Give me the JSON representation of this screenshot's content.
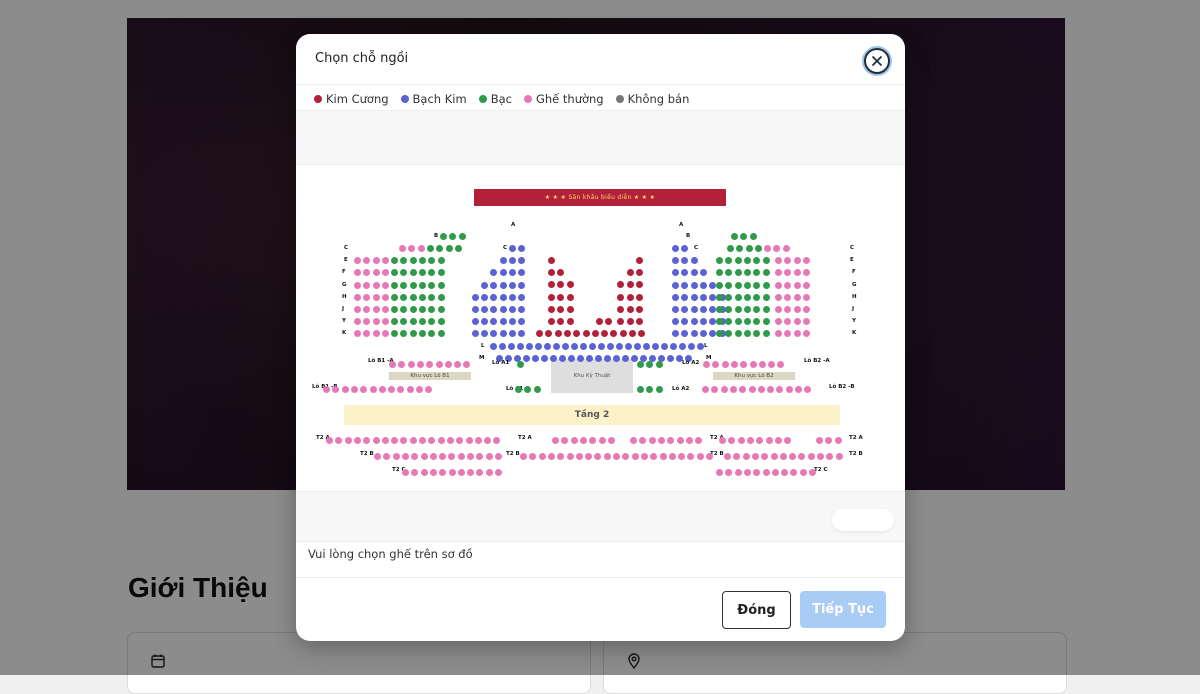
{
  "page": {
    "intro_title": "Giới Thiệu"
  },
  "modal": {
    "title": "Chọn chỗ ngồi",
    "legend": [
      {
        "label": "Kim Cương",
        "color": "#b3203a"
      },
      {
        "label": "Bạch Kim",
        "color": "#5b62d6"
      },
      {
        "label": "Bạc",
        "color": "#2f9b4a"
      },
      {
        "label": "Ghế thường",
        "color": "#e778b6"
      },
      {
        "label": "Không bán",
        "color": "#757575"
      }
    ],
    "hint": "Vui lòng chọn ghế trên sơ đồ",
    "close_button": "Đóng",
    "next_button": "Tiếp Tục"
  },
  "seatmap": {
    "stage_label": "★ ★ ★  Sân khấu biểu diễn  ★ ★ ★",
    "zone_b1": "Khu vực Lô B1",
    "zone_b2": "Khu vực Lô B2",
    "tech": "Khu Kỹ Thuật",
    "tang2": "Tầng 2",
    "labels": [
      "A",
      "B",
      "C",
      "E",
      "F",
      "G",
      "H",
      "J",
      "Y",
      "K",
      "L",
      "M",
      "Lô B1 -A",
      "Lô A1",
      "Lô A2",
      "Lô B2 -A",
      "Lô B1 -B",
      "Lô B2 -B",
      "T2 A",
      "T2 B",
      "T2 C"
    ]
  },
  "icons": {
    "close": "close-icon",
    "calendar": "calendar-icon",
    "location": "location-pin-icon"
  }
}
